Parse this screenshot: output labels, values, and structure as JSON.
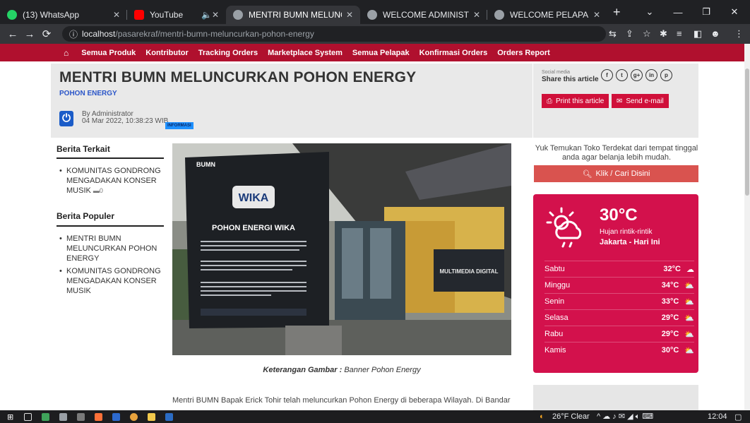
{
  "browser": {
    "tabs": [
      {
        "title": "(13) WhatsApp",
        "fav_color": "#25d366"
      },
      {
        "title": "YouTube",
        "fav_color": "#ff0000"
      },
      {
        "title": "MENTRI BUMN MELUNCURK",
        "fav_color": "#9aa0a6",
        "active": true
      },
      {
        "title": "WELCOME ADMINISTRATOR",
        "fav_color": "#9aa0a6"
      },
      {
        "title": "WELCOME PELAPAK",
        "fav_color": "#9aa0a6"
      }
    ],
    "url_host": "localhost",
    "url_path": "/pasarekraf/mentri-bumn-meluncurkan-pohon-energy"
  },
  "nav": {
    "items": [
      "Semua Produk",
      "Kontributor",
      "Tracking Orders",
      "Marketplace System",
      "Semua Pelapak",
      "Konfirmasi Orders",
      "Orders Report"
    ]
  },
  "article": {
    "title": "MENTRI BUMN MELUNCURKAN POHON ENERGY",
    "subtitle": "POHON ENERGY",
    "author": "By Administrator",
    "date": "04 Mar 2022, 10:38:23 WIB",
    "badge": "INFORMASI",
    "caption_label": "Keterangan Gambar :",
    "caption_text": " Banner Pohon Energy",
    "body_start": "Mentri BUMN Bapak Erick Tohir telah meluncurkan Pohon Energy di beberapa Wilayah. Di Bandar"
  },
  "share": {
    "label": "Social media",
    "title": "Share this article",
    "print": "Print this article",
    "email": "Send e-mail"
  },
  "sidebar": {
    "terkait_title": "Berita Terkait",
    "terkait": [
      "KOMUNITAS GONDRONG MENGADAKAN KONSER MUSIK"
    ],
    "terkait_comments": "0",
    "populer_title": "Berita Populer",
    "populer": [
      "MENTRI BUMN MELUNCURKAN POHON ENERGY",
      "KOMUNITAS GONDRONG MENGADAKAN KONSER MUSIK"
    ]
  },
  "toko": {
    "text": "Yuk Temukan Toko Terdekat dari tempat tinggal anda agar belanja lebih mudah.",
    "button": "Klik / Cari Disini"
  },
  "weather": {
    "temp": "30°C",
    "desc": "Hujan rintik-rintik",
    "city": "Jakarta - Hari Ini",
    "forecast": [
      {
        "day": "Sabtu",
        "temp": "32°C"
      },
      {
        "day": "Minggu",
        "temp": "34°C"
      },
      {
        "day": "Senin",
        "temp": "33°C"
      },
      {
        "day": "Selasa",
        "temp": "29°C"
      },
      {
        "day": "Rabu",
        "temp": "29°C"
      },
      {
        "day": "Kamis",
        "temp": "30°C"
      }
    ]
  },
  "banner": {
    "bumn": "BUMN",
    "wika": "WIKA",
    "sign_title": "POHON ENERGI WIKA",
    "multimedia": "MULTIMEDIA DIGITAL"
  },
  "taskbar": {
    "weather": "26°F Clear",
    "time": "12:04"
  }
}
